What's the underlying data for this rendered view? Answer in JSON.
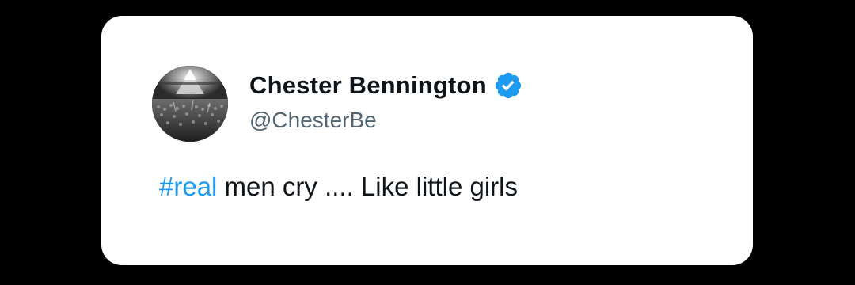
{
  "tweet": {
    "author": {
      "display_name": "Chester Bennington",
      "handle": "@ChesterBe",
      "verified": true,
      "verified_icon": "verified-badge-icon",
      "avatar": "concert-crowd-photo"
    },
    "text": {
      "hashtag": "#real",
      "body": " men cry .... Like little girls"
    }
  },
  "colors": {
    "background": "#000000",
    "card": "#ffffff",
    "name": "#0f1419",
    "handle": "#536471",
    "hashtag": "#1d9bf0",
    "verified": "#1d9bf0"
  }
}
